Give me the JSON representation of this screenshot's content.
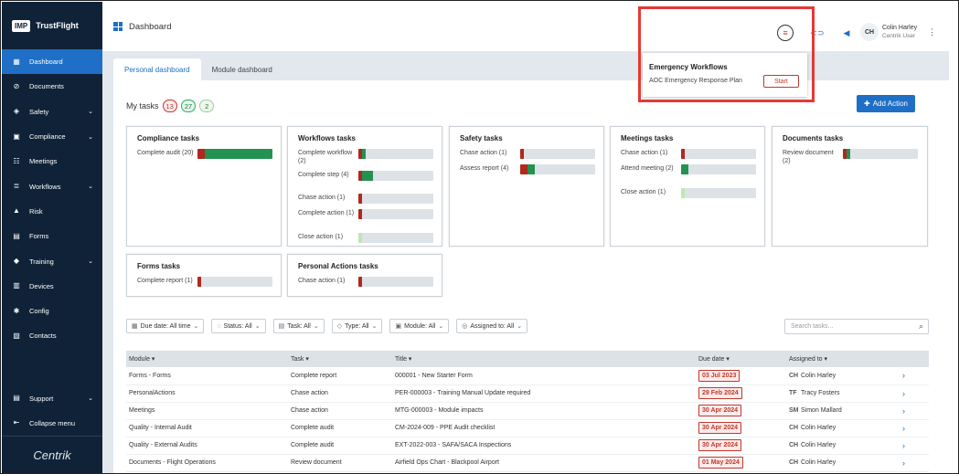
{
  "sidebar": {
    "logo": "IMP",
    "brand": "TrustFlight",
    "items": [
      {
        "label": "Dashboard",
        "icon": "dashboard-icon",
        "active": true,
        "chevron": false
      },
      {
        "label": "Documents",
        "icon": "paperclip-icon",
        "chevron": false
      },
      {
        "label": "Safety",
        "icon": "shield-icon",
        "chevron": true
      },
      {
        "label": "Compliance",
        "icon": "briefcase-icon",
        "chevron": true
      },
      {
        "label": "Meetings",
        "icon": "people-icon",
        "chevron": false
      },
      {
        "label": "Workflows",
        "icon": "layers-icon",
        "chevron": true
      },
      {
        "label": "Risk",
        "icon": "warning-icon",
        "chevron": false
      },
      {
        "label": "Forms",
        "icon": "form-icon",
        "chevron": false
      },
      {
        "label": "Training",
        "icon": "graduation-cap-icon",
        "chevron": true
      },
      {
        "label": "Devices",
        "icon": "devices-icon",
        "chevron": false
      },
      {
        "label": "Config",
        "icon": "gear-icon",
        "chevron": false
      },
      {
        "label": "Contacts",
        "icon": "contacts-icon",
        "chevron": false
      }
    ],
    "support": "Support",
    "collapse": "Collapse menu",
    "footer_logo": "Centrik"
  },
  "header": {
    "title": "Dashboard",
    "user_initials": "CH",
    "user_name": "Colin Harley",
    "user_role": "Centrik User"
  },
  "tabs": [
    "Personal dashboard",
    "Module dashboard"
  ],
  "mytasks": {
    "label": "My tasks",
    "red": "13",
    "green": "27",
    "lightgreen": "2",
    "add_button": "Add Action"
  },
  "popup": {
    "title": "Emergency Workflows",
    "item": "AOC Emergency Response Plan",
    "button": "Start"
  },
  "cards": [
    {
      "title": "Compliance tasks",
      "rows": [
        {
          "label": "Complete audit (20)",
          "red": 0.1,
          "green": 0.9,
          "light": 0
        }
      ]
    },
    {
      "title": "Workflows tasks",
      "rows": [
        {
          "label": "Complete workflow (2)",
          "red": 0.05,
          "green": 0.05,
          "light": 0
        },
        {
          "label": "Complete step (4)",
          "red": 0.05,
          "green": 0.15,
          "light": 0
        },
        {
          "label": "Chase action (1)",
          "red": 0.05,
          "green": 0,
          "light": 0
        },
        {
          "label": "Complete action (1)",
          "red": 0.05,
          "green": 0,
          "light": 0
        },
        {
          "label": "Close action (1)",
          "red": 0,
          "green": 0,
          "light": 0.05
        }
      ]
    },
    {
      "title": "Safety tasks",
      "rows": [
        {
          "label": "Chase action (1)",
          "red": 0.05,
          "green": 0,
          "light": 0
        },
        {
          "label": "Assess report (4)",
          "red": 0.1,
          "green": 0.1,
          "light": 0
        }
      ]
    },
    {
      "title": "Meetings tasks",
      "rows": [
        {
          "label": "Chase action (1)",
          "red": 0.05,
          "green": 0,
          "light": 0
        },
        {
          "label": "Attend meeting (2)",
          "red": 0,
          "green": 0.1,
          "light": 0
        },
        {
          "label": "Close action (1)",
          "red": 0,
          "green": 0,
          "light": 0.05
        }
      ]
    },
    {
      "title": "Documents tasks",
      "rows": [
        {
          "label": "Review document (2)",
          "red": 0.05,
          "green": 0.05,
          "light": 0
        }
      ]
    },
    {
      "title": "Forms tasks",
      "rows": [
        {
          "label": "Complete report (1)",
          "red": 0.05,
          "green": 0,
          "light": 0
        }
      ]
    },
    {
      "title": "Personal Actions tasks",
      "rows": [
        {
          "label": "Chase action (1)",
          "red": 0.05,
          "green": 0,
          "light": 0
        }
      ]
    }
  ],
  "filters": [
    {
      "label": "Due date: All time",
      "icon": "calendar-icon"
    },
    {
      "label": "Status: All",
      "icon": "status-icon"
    },
    {
      "label": "Task: All",
      "icon": "task-icon"
    },
    {
      "label": "Type: All",
      "icon": "tag-icon"
    },
    {
      "label": "Module: All",
      "icon": "module-icon"
    },
    {
      "label": "Assigned to: All",
      "icon": "user-icon"
    }
  ],
  "search_placeholder": "Search tasks...",
  "table": {
    "headers": [
      "Module",
      "Task",
      "Title",
      "Due date",
      "Assigned to"
    ],
    "rows": [
      {
        "module": "Forms - Forms",
        "task": "Complete report",
        "title": "000001 - New Starter Form",
        "due": "03 Jul 2023",
        "ini": "CH",
        "assignee": "Colin Harley"
      },
      {
        "module": "PersonalActions",
        "task": "Chase action",
        "title": "PER-000003 - Training Manual Update required",
        "due": "29 Feb 2024",
        "ini": "TF",
        "assignee": "Tracy Fosters"
      },
      {
        "module": "Meetings",
        "task": "Chase action",
        "title": "MTG-000003 - Module impacts",
        "due": "30 Apr 2024",
        "ini": "SM",
        "assignee": "Simon Mallard"
      },
      {
        "module": "Quality - Internal Audit",
        "task": "Complete audit",
        "title": "CM-2024-009 - PPE Audit checklist",
        "due": "30 Apr 2024",
        "ini": "CH",
        "assignee": "Colin Harley"
      },
      {
        "module": "Quality - External Audits",
        "task": "Complete audit",
        "title": "EXT-2022-003 - SAFA/SACA Inspections",
        "due": "30 Apr 2024",
        "ini": "CH",
        "assignee": "Colin Harley"
      },
      {
        "module": "Documents - Flight Operations",
        "task": "Review document",
        "title": "Airfield Ops Chart - Blackpool Airport",
        "due": "01 May 2024",
        "ini": "CH",
        "assignee": "Colin Harley"
      }
    ]
  },
  "colors": {
    "red": "#b0281e",
    "green": "#239150",
    "light": "#bde8b0",
    "accent": "#1e6fc5"
  }
}
